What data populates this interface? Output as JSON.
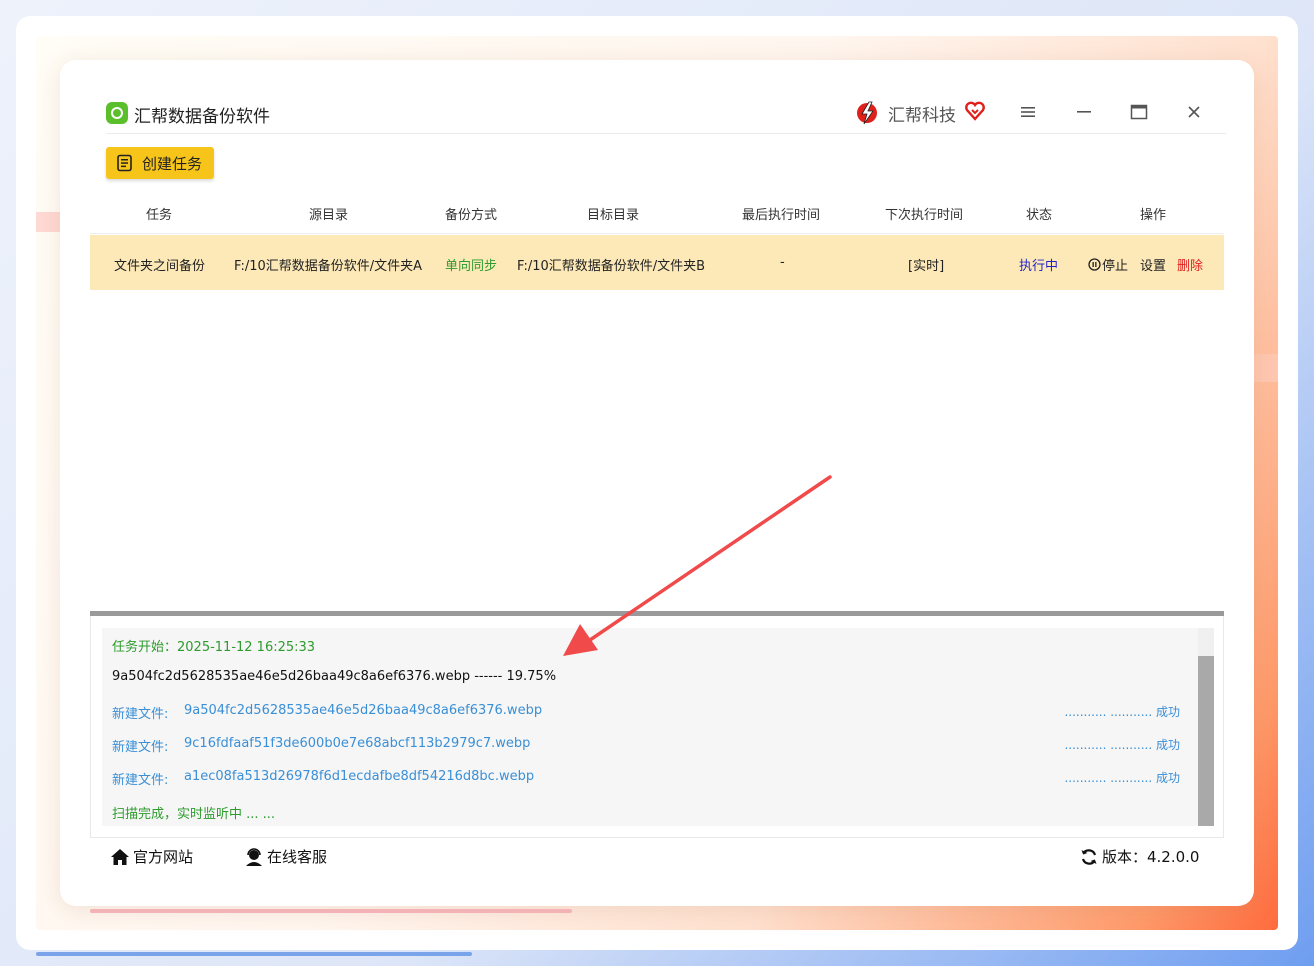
{
  "app": {
    "title": "汇帮数据备份软件"
  },
  "brand": {
    "name": "汇帮科技"
  },
  "toolbar": {
    "create_task_label": "创建任务"
  },
  "table": {
    "headers": [
      "任务",
      "源目录",
      "备份方式",
      "目标目录",
      "最后执行时间",
      "下次执行时间",
      "状态",
      "操作"
    ],
    "rows": [
      {
        "task": "文件夹之间备份",
        "source": "F:/10汇帮数据备份软件/文件夹A",
        "mode": "单向同步",
        "target": "F:/10汇帮数据备份软件/文件夹B",
        "last_run": "-",
        "next_run": "[实时]",
        "status": "执行中",
        "actions": {
          "stop": "停止",
          "settings": "设置",
          "delete": "删除"
        }
      }
    ]
  },
  "log": {
    "start_line": "任务开始：2025-11-12 16:25:33",
    "progress_line": "9a504fc2d5628535ae46e5d26baa49c8a6ef6376.webp ------ 19.75%",
    "entries": [
      {
        "label": "新建文件:",
        "file": "9a504fc2d5628535ae46e5d26baa49c8a6ef6376.webp",
        "status": "........... ........... 成功"
      },
      {
        "label": "新建文件:",
        "file": "9c16fdfaaf51f3de600b0e7e68abcf113b2979c7.webp",
        "status": "........... ........... 成功"
      },
      {
        "label": "新建文件:",
        "file": "a1ec08fa513d26978f6d1ecdafbe8df54216d8bc.webp",
        "status": "........... ........... 成功"
      }
    ],
    "end_line": "扫描完成，实时监听中 ... ..."
  },
  "footer": {
    "website_label": "官方网站",
    "support_label": "在线客服",
    "version_label": "版本：4.2.0.0"
  },
  "colors": {
    "accent": "#f7c51a",
    "row_highlight": "#fde9b8",
    "success": "#2d9b2d",
    "link": "#3a8fd6",
    "danger": "#e02020"
  },
  "icons": [
    "app-logo-icon",
    "brand-bolt-icon",
    "brand-heart-icon",
    "menu-icon",
    "minimize-icon",
    "maximize-icon",
    "close-icon",
    "task-list-icon",
    "pause-icon",
    "home-icon",
    "support-icon",
    "refresh-icon"
  ]
}
